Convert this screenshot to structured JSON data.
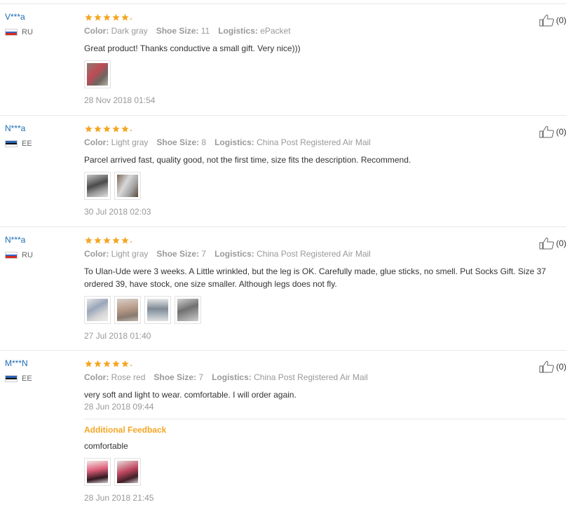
{
  "colors": {
    "accent_star": "#f5a623",
    "buyer_link": "#1a6bb8",
    "muted": "#999999",
    "additional_feedback": "#f5a623"
  },
  "labels": {
    "color": "Color:",
    "shoe_size": "Shoe Size:",
    "logistics": "Logistics:",
    "additional_feedback": "Additional Feedback"
  },
  "reviews": [
    {
      "buyer": "V***a",
      "country": "RU",
      "flag": "russia-flag",
      "rating": 5,
      "color": "Dark gray",
      "shoe_size": "11",
      "logistics": "ePacket",
      "text": "Great product! Thanks conductive a small gift. Very nice)))",
      "photos": 1,
      "date": "28 Nov 2018 01:54",
      "helpful": "(0)"
    },
    {
      "buyer": "N***a",
      "country": "EE",
      "flag": "estonia-flag",
      "rating": 5,
      "color": "Light gray",
      "shoe_size": "8",
      "logistics": "China Post Registered Air Mail",
      "text": "Parcel arrived fast, quality good, not the first time, size fits the description. Recommend.",
      "photos": 2,
      "date": "30 Jul 2018 02:03",
      "helpful": "(0)"
    },
    {
      "buyer": "N***a",
      "country": "RU",
      "flag": "russia-flag",
      "rating": 5,
      "color": "Light gray",
      "shoe_size": "7",
      "logistics": "China Post Registered Air Mail",
      "text": "To Ulan-Ude were 3 weeks. A Little wrinkled, but the leg is OK. Carefully made, glue sticks, no smell. Put Socks Gift. Size 37 ordered 39, have stock, one size smaller. Although legs does not fly.",
      "photos": 4,
      "date": "27 Jul 2018 01:40",
      "helpful": "(0)"
    },
    {
      "buyer": "M***N",
      "country": "EE",
      "flag": "estonia-flag",
      "rating": 5,
      "color": "Rose red",
      "shoe_size": "7",
      "logistics": "China Post Registered Air Mail",
      "text": "very soft and light to wear. comfortable. I will order again.",
      "date": "28 Jun 2018 09:44",
      "helpful": "(0)",
      "additional": {
        "text": "comfortable",
        "photos": 2,
        "date": "28 Jun 2018 21:45"
      }
    }
  ]
}
